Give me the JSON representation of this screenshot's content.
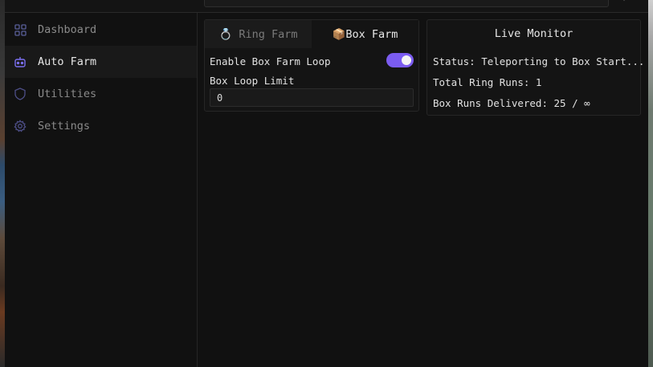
{
  "sidebar": {
    "items": [
      {
        "label": "Dashboard",
        "icon": "dashboard-icon",
        "active": false
      },
      {
        "label": "Auto Farm",
        "icon": "robot-icon",
        "active": true
      },
      {
        "label": "Utilities",
        "icon": "shield-icon",
        "active": false
      },
      {
        "label": "Settings",
        "icon": "gear-icon",
        "active": false
      }
    ]
  },
  "farm_panel": {
    "tabs": [
      {
        "label": "💍 Ring Farm",
        "active": false
      },
      {
        "label": "📦Box Farm",
        "active": true
      }
    ],
    "toggle_label": "Enable Box Farm Loop",
    "toggle_on": true,
    "limit_label": "Box Loop Limit",
    "limit_value": "0"
  },
  "monitor": {
    "title": "Live Monitor",
    "status": "Status: Teleporting to Box Start...",
    "ring_runs": "Total Ring Runs: 1",
    "box_runs": "Box Runs Delivered: 25 / ∞"
  },
  "colors": {
    "accent": "#7b5cf0",
    "background": "#111111",
    "panel": "#141414"
  }
}
